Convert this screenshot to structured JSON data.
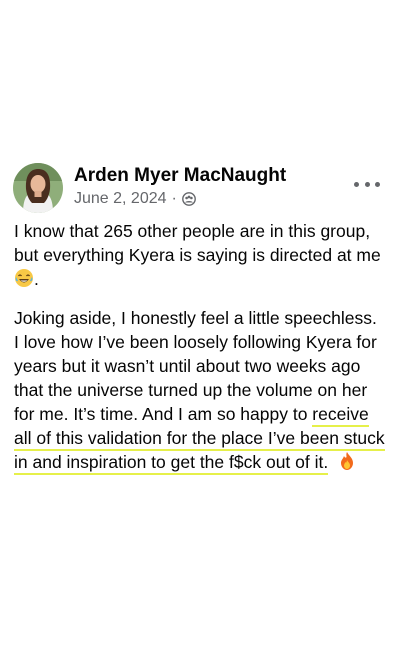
{
  "post": {
    "author": "Arden Myer MacNaught",
    "date": "June 2, 2024",
    "separator": "·",
    "privacy_icon": "group-icon",
    "more_icon": "more-options-icon",
    "paragraph1": {
      "text": "I know that 265 other people are in this group, but everything Kyera is saying is directed at me",
      "emoji": "crying-laughing-emoji",
      "end": "."
    },
    "paragraph2": {
      "plain": "Joking aside, I honestly feel a little speechless. I love how I’ve been loosely following Kyera for years but it wasn’t until about two weeks ago that the universe turned up the volume on her for me.  It’s time. And I am so happy to ",
      "highlighted": "receive all of this validation for the place I’ve been stuck in and inspiration to get the f$ck out of it.",
      "emoji": "fire-emoji"
    },
    "colors": {
      "highlight_underline": "#e6f04a",
      "meta_text": "#65676b",
      "body_text": "#050505"
    }
  }
}
